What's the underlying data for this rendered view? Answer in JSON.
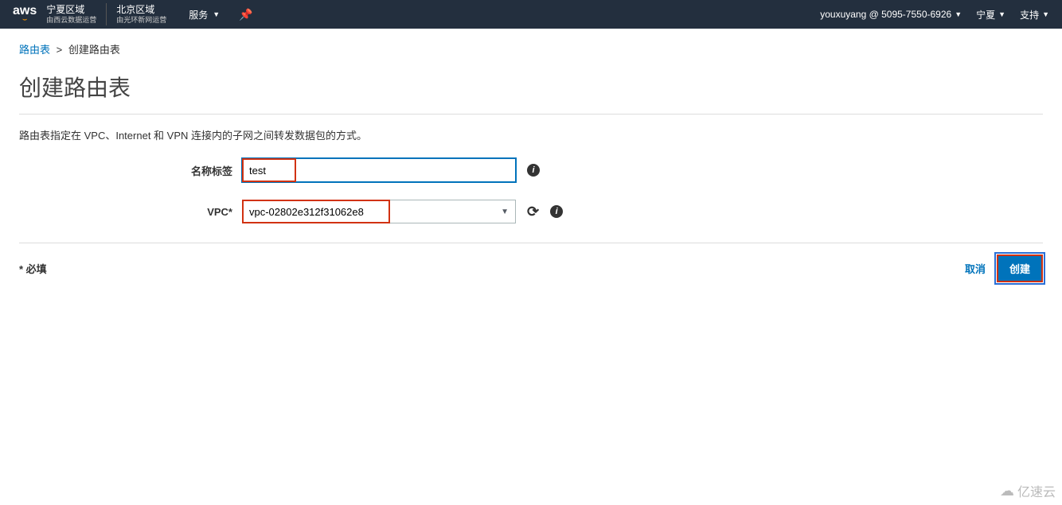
{
  "topnav": {
    "logo": "aws",
    "region1_name": "宁夏区域",
    "region1_sub": "由西云数据运营",
    "region2_name": "北京区域",
    "region2_sub": "由光环新网运营",
    "services_label": "服务",
    "account": "youxuyang @ 5095-7550-6926",
    "region_short": "宁夏",
    "support_label": "支持"
  },
  "breadcrumb": {
    "link": "路由表",
    "sep": ">",
    "current": "创建路由表"
  },
  "page": {
    "title": "创建路由表",
    "description": "路由表指定在 VPC、Internet 和 VPN 连接内的子网之间转发数据包的方式。"
  },
  "form": {
    "name_label": "名称标签",
    "name_value": "test",
    "vpc_label": "VPC*",
    "vpc_value": "vpc-02802e312f31062e8"
  },
  "footer": {
    "required_note": "* 必填",
    "cancel_label": "取消",
    "create_label": "创建"
  },
  "watermark": {
    "text": "亿速云"
  }
}
